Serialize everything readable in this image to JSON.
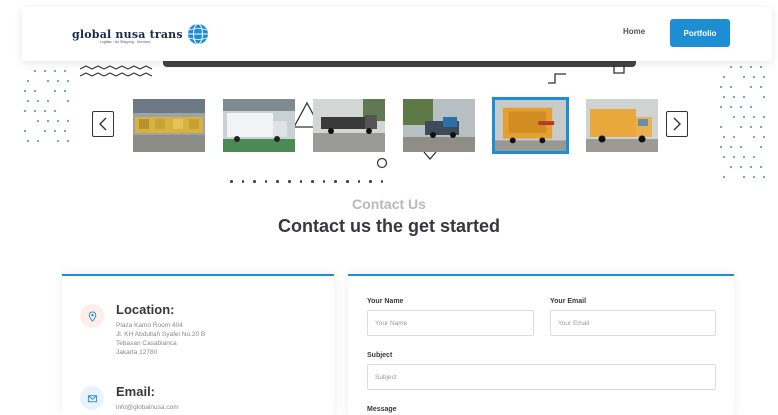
{
  "header": {
    "logo_text": "global nusa trans",
    "logo_subtext": "Logistic · Air Shipping · Services",
    "nav": {
      "home": "Home",
      "portfolio": "Portfolio"
    }
  },
  "gallery": {
    "thumbnails": [
      {
        "name": "trucks-parked-row",
        "color": "#b9a36e"
      },
      {
        "name": "white-truck-warehouse",
        "color": "#c9d4d8"
      },
      {
        "name": "flatbed-truck",
        "color": "#6b6b6b"
      },
      {
        "name": "truck-yard",
        "color": "#7a8b6a"
      },
      {
        "name": "yellow-cargo-truck",
        "color": "#e2a13a"
      },
      {
        "name": "yellow-box-truck",
        "color": "#e8a83c"
      }
    ],
    "active_index": 4
  },
  "contact": {
    "section_label": "Contact Us",
    "section_title": "Contact us the get started",
    "location": {
      "title": "Location:",
      "lines": [
        "Plaza Kamo Room 404",
        "Jl. KH Abdullah Syafei No.20 B",
        "Tebasan Casablanca",
        "Jakarta 12780"
      ]
    },
    "email": {
      "title": "Email:",
      "value": "info@globalnusa.com"
    }
  },
  "form": {
    "name": {
      "label": "Your Name",
      "placeholder": "Your Name"
    },
    "email": {
      "label": "Your Email",
      "placeholder": "Your Email"
    },
    "subject": {
      "label": "Subject",
      "placeholder": "Subject"
    },
    "message": {
      "label": "Message"
    }
  },
  "colors": {
    "accent": "#1d8ed4",
    "text": "#37373f",
    "muted": "#b9b9b9"
  }
}
